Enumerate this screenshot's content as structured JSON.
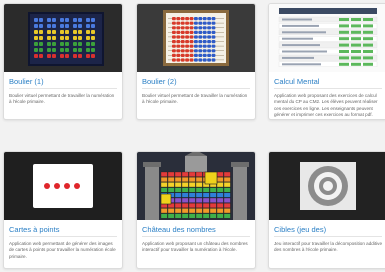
{
  "cards": [
    {
      "title": "Boulier (1)",
      "description": "Boulier virtuel permettant de travailler la numération à l'école primaire.",
      "thumbnail_icon": "abacus-dark-thumbnail"
    },
    {
      "title": "Boulier (2)",
      "description": "Boulier virtuel permettant de travailler la numération à l'école primaire.",
      "thumbnail_icon": "abacus-color-thumbnail"
    },
    {
      "title": "Calcul Mental",
      "description": "Application web proposant des exercices de calcul mental du CP au CM2. Les élèves peuvent réaliser ces exercices en ligne. Les enseignants peuvent générer et imprimer ces exercices au format pdf.",
      "thumbnail_icon": "table-thumbnail"
    },
    {
      "title": "Cartes à points",
      "description": "Application web permettant de générer des images de cartes à points pour travailler la numération école primaire.",
      "thumbnail_icon": "dot-cards-thumbnail"
    },
    {
      "title": "Château des nombres",
      "description": "Application web proposant un château des nombres interactif pour travailler la numération à l'école.",
      "thumbnail_icon": "castle-thumbnail"
    },
    {
      "title": "Cibles (jeu des)",
      "description": "Jeu interactif pour travailler la décomposition additive des nombres à l'école primaire.",
      "thumbnail_icon": "target-thumbnail"
    }
  ],
  "colors": {
    "title_blue": "#2a7fc5",
    "page_bg": "#f2f2f2",
    "card_bg": "#ffffff"
  }
}
